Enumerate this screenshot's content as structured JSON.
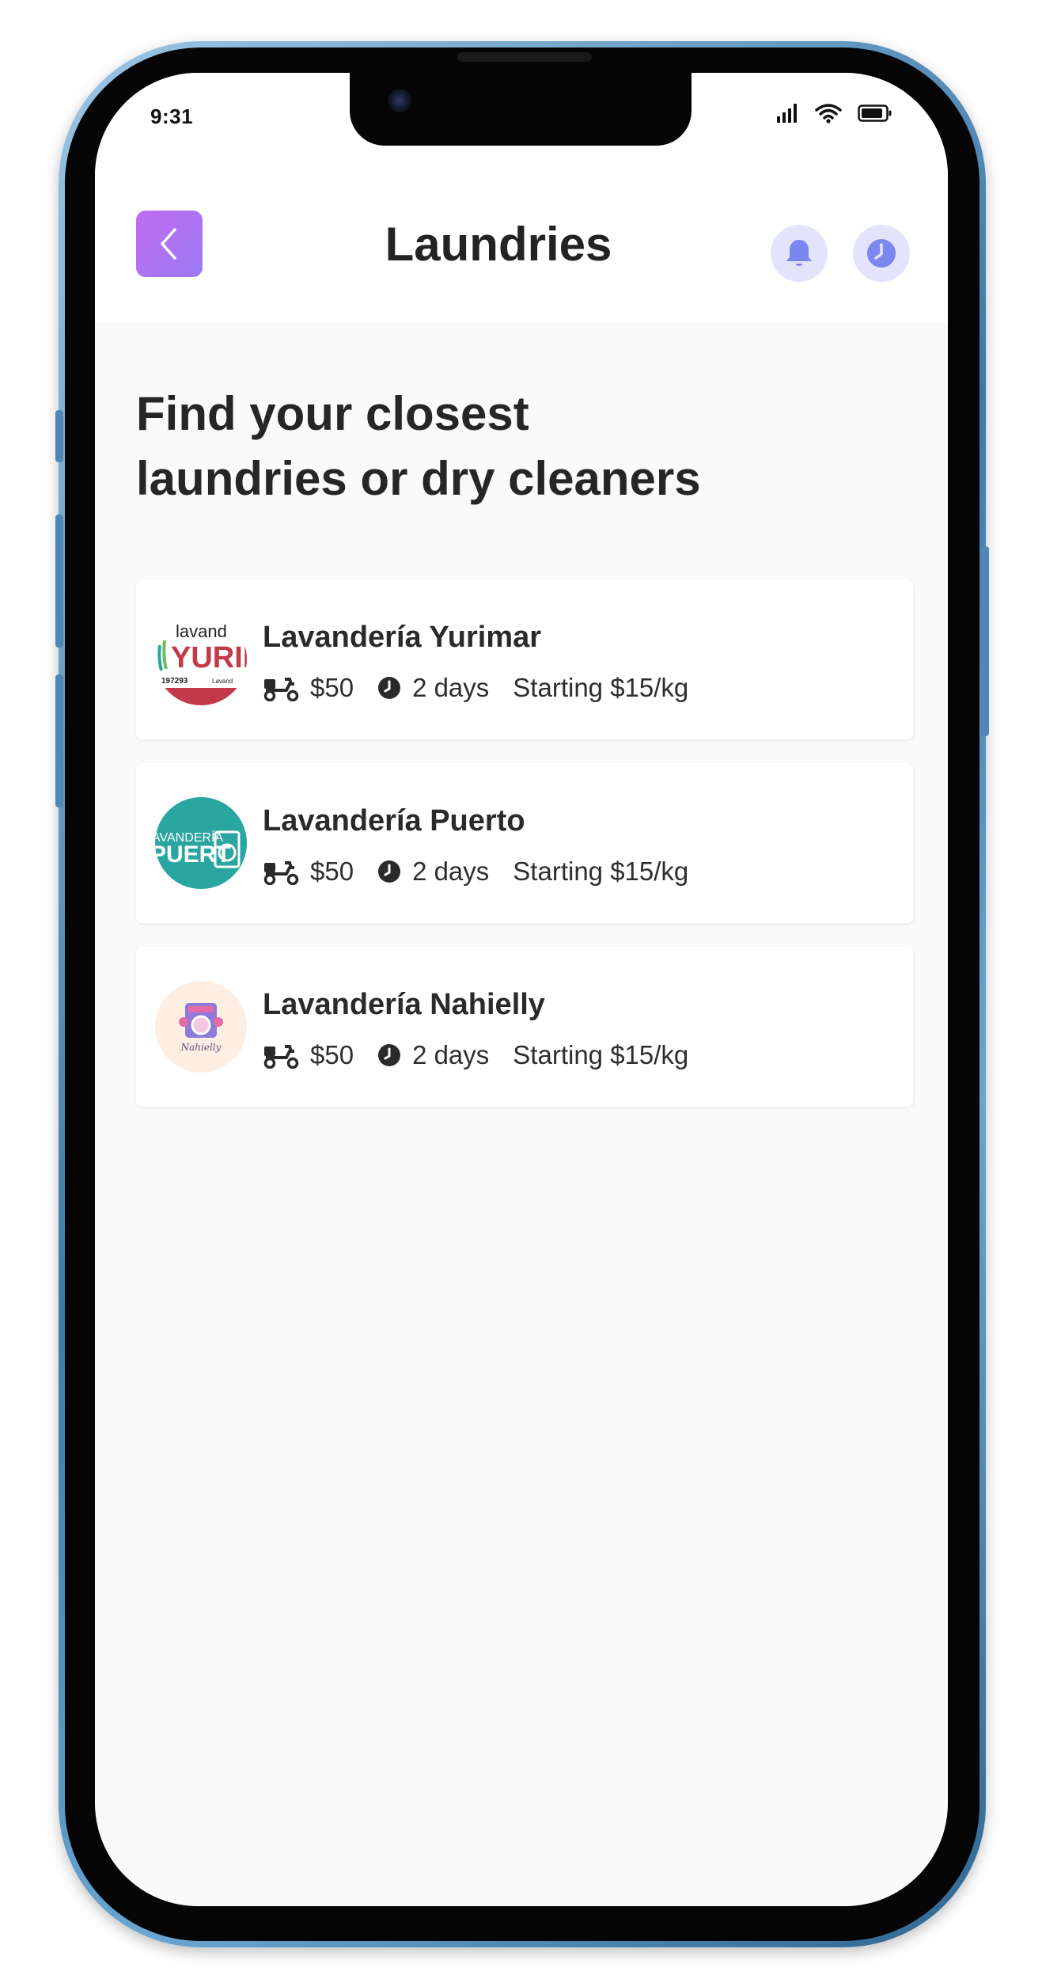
{
  "status_bar": {
    "time": "9:31",
    "icons": [
      "cellular-signal-icon",
      "wifi-icon",
      "battery-icon"
    ]
  },
  "header": {
    "title": "Laundries",
    "back_icon": "chevron-left-icon",
    "actions": [
      "bell-icon",
      "clock-icon"
    ]
  },
  "main": {
    "headline_line1": "Find your closest",
    "headline_line2": "laundries or dry cleaners",
    "laundries": [
      {
        "name": "Lavandería Yurimar",
        "delivery_price": "$50",
        "turnaround": "2 days",
        "price_per_kg": "Starting $15/kg",
        "logo": {
          "line1": "lavand",
          "line2": "YURIM",
          "line3": "197293",
          "line4": "Lavand"
        }
      },
      {
        "name": "Lavandería Puerto",
        "delivery_price": "$50",
        "turnaround": "2 days",
        "price_per_kg": "Starting $15/kg",
        "logo": {
          "line1": "AVANDERÍA",
          "line2": "PUERT"
        }
      },
      {
        "name": "Lavandería Nahielly",
        "delivery_price": "$50",
        "turnaround": "2 days",
        "price_per_kg": "Starting $15/kg",
        "logo": {
          "line1": "Nahielly"
        }
      }
    ]
  },
  "colors": {
    "accent_start": "#c06bf0",
    "accent_end": "#9b7bf2",
    "icon_button_bg": "#e3e4fb",
    "icon_button_fg": "#7b86ef",
    "puerto_teal": "#2aa6a0",
    "nahielly_bg": "#fdeee4",
    "yurimar_red": "#c23a4a"
  }
}
